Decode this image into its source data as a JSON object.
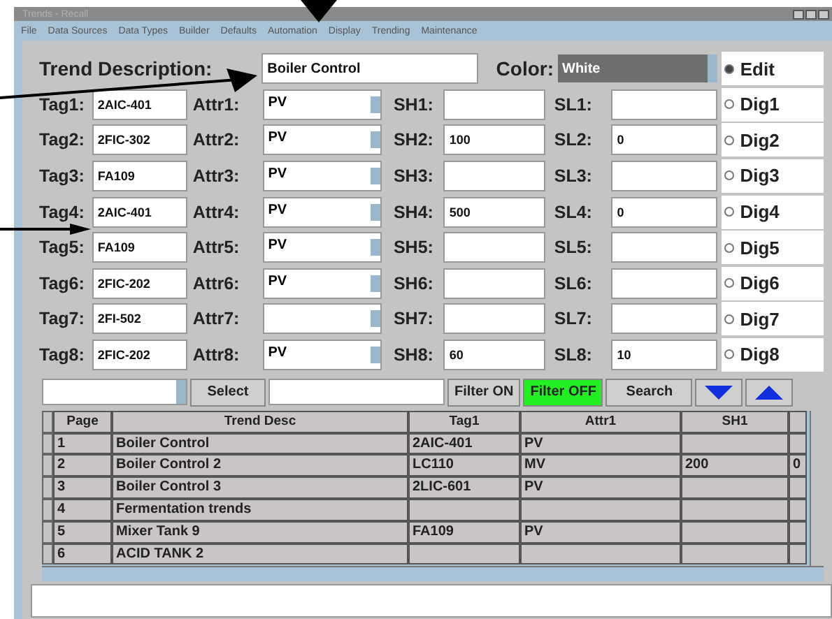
{
  "window": {
    "title": "Trends - Recall"
  },
  "menu": [
    "File",
    "Data Sources",
    "Data Types",
    "Builder",
    "Defaults",
    "Automation",
    "Display",
    "Trending",
    "Maintenance"
  ],
  "trend_description": {
    "label": "Trend Description:",
    "value": "Boiler Control"
  },
  "color": {
    "label": "Color:",
    "value": "White"
  },
  "mode_options": [
    {
      "label": "Edit",
      "selected": true
    },
    {
      "label": "Dig1",
      "selected": false
    },
    {
      "label": "Dig2",
      "selected": false
    },
    {
      "label": "Dig3",
      "selected": false
    },
    {
      "label": "Dig4",
      "selected": false
    },
    {
      "label": "Dig5",
      "selected": false
    },
    {
      "label": "Dig6",
      "selected": false
    },
    {
      "label": "Dig7",
      "selected": false
    },
    {
      "label": "Dig8",
      "selected": false
    }
  ],
  "tag_rows": [
    {
      "tag_label": "Tag1:",
      "tag": "2AIC-401",
      "attr_label": "Attr1:",
      "attr": "PV",
      "sh_label": "SH1:",
      "sh": "",
      "sl_label": "SL1:",
      "sl": ""
    },
    {
      "tag_label": "Tag2:",
      "tag": "2FIC-302",
      "attr_label": "Attr2:",
      "attr": "PV",
      "sh_label": "SH2:",
      "sh": "100",
      "sl_label": "SL2:",
      "sl": "0"
    },
    {
      "tag_label": "Tag3:",
      "tag": "FA109",
      "attr_label": "Attr3:",
      "attr": "PV",
      "sh_label": "SH3:",
      "sh": "",
      "sl_label": "SL3:",
      "sl": ""
    },
    {
      "tag_label": "Tag4:",
      "tag": "2AIC-401",
      "attr_label": "Attr4:",
      "attr": "PV",
      "sh_label": "SH4:",
      "sh": "500",
      "sl_label": "SL4:",
      "sl": "0"
    },
    {
      "tag_label": "Tag5:",
      "tag": "FA109",
      "attr_label": "Attr5:",
      "attr": "PV",
      "sh_label": "SH5:",
      "sh": "",
      "sl_label": "SL5:",
      "sl": ""
    },
    {
      "tag_label": "Tag6:",
      "tag": "2FIC-202",
      "attr_label": "Attr6:",
      "attr": "PV",
      "sh_label": "SH6:",
      "sh": "",
      "sl_label": "SL6:",
      "sl": ""
    },
    {
      "tag_label": "Tag7:",
      "tag": "2FI-502",
      "attr_label": "Attr7:",
      "attr": "",
      "sh_label": "SH7:",
      "sh": "",
      "sl_label": "SL7:",
      "sl": ""
    },
    {
      "tag_label": "Tag8:",
      "tag": "2FIC-202",
      "attr_label": "Attr8:",
      "attr": "PV",
      "sh_label": "SH8:",
      "sh": "60",
      "sl_label": "SL8:",
      "sl": "10"
    }
  ],
  "toolbar": {
    "select_button": "Select",
    "filters": [
      {
        "label": "Filter ON",
        "selected": false
      },
      {
        "label": "Filter OFF",
        "selected": true
      }
    ],
    "search_button": "Search"
  },
  "table": {
    "columns": [
      "Page",
      "Trend Desc",
      "Tag1",
      "Attr1",
      "SH1"
    ],
    "rows": [
      [
        "1",
        "Boiler Control",
        "2AIC-401",
        "PV",
        "",
        ""
      ],
      [
        "2",
        "Boiler Control 2",
        "LC110",
        "MV",
        "200",
        "0"
      ],
      [
        "3",
        "Boiler Control 3",
        "2LIC-601",
        "PV",
        "",
        ""
      ],
      [
        "4",
        "Fermentation trends",
        "",
        "",
        "",
        ""
      ],
      [
        "5",
        "Mixer Tank 9",
        "FA109",
        "PV",
        "",
        ""
      ],
      [
        "6",
        "ACID TANK 2",
        "",
        "",
        "",
        ""
      ]
    ]
  }
}
